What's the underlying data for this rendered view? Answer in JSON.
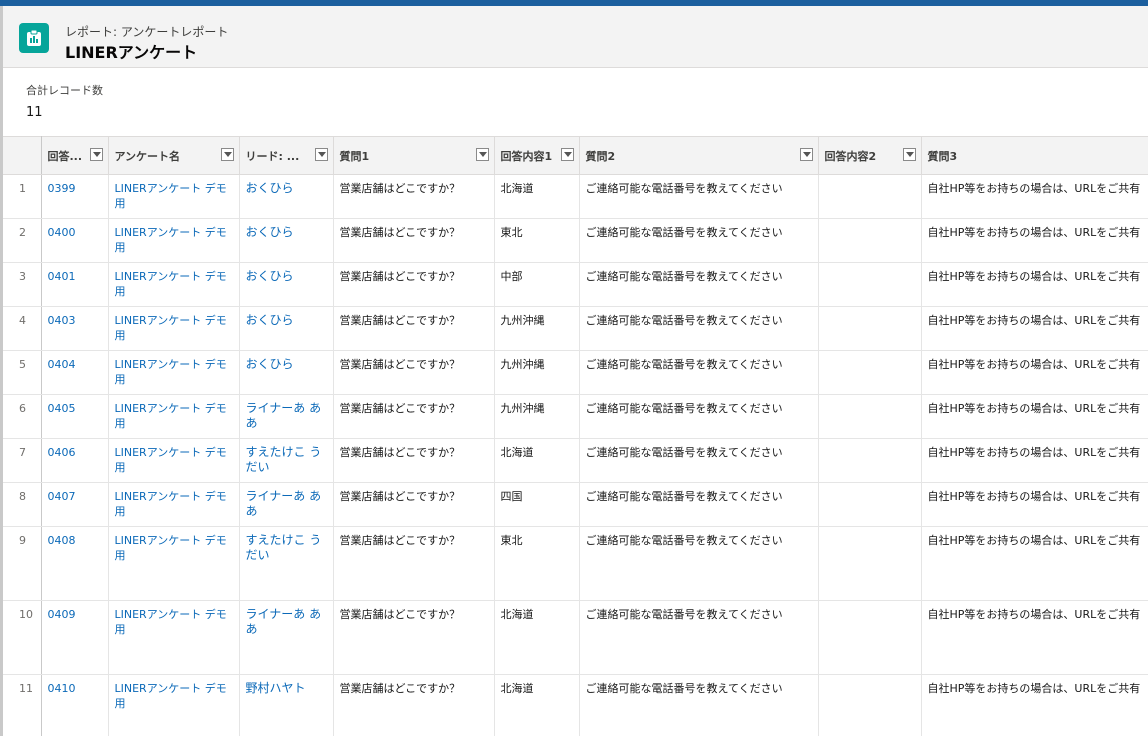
{
  "header": {
    "subtitle": "レポート: アンケートレポート",
    "title": "LINERアンケート"
  },
  "summary": {
    "label": "合計レコード数",
    "value": "11"
  },
  "table": {
    "columns": [
      "回答...",
      "アンケート名",
      "リード: ...",
      "質問1",
      "回答内容1",
      "質問2",
      "回答内容2",
      "質問3"
    ],
    "rows": [
      [
        "1",
        "0399",
        "LINERアンケート デモ用",
        "おくひら",
        "営業店舗はどこですか？",
        "北海道",
        "ご連絡可能な電話番号を教えてください",
        "",
        "自社HP等をお持ちの場合は、URLをご共有"
      ],
      [
        "2",
        "0400",
        "LINERアンケート デモ用",
        "おくひら",
        "営業店舗はどこですか？",
        "東北",
        "ご連絡可能な電話番号を教えてください",
        "",
        "自社HP等をお持ちの場合は、URLをご共有"
      ],
      [
        "3",
        "0401",
        "LINERアンケート デモ用",
        "おくひら",
        "営業店舗はどこですか？",
        "中部",
        "ご連絡可能な電話番号を教えてください",
        "",
        "自社HP等をお持ちの場合は、URLをご共有"
      ],
      [
        "4",
        "0403",
        "LINERアンケート デモ用",
        "おくひら",
        "営業店舗はどこですか？",
        "九州沖縄",
        "ご連絡可能な電話番号を教えてください",
        "",
        "自社HP等をお持ちの場合は、URLをご共有"
      ],
      [
        "5",
        "0404",
        "LINERアンケート デモ用",
        "おくひら",
        "営業店舗はどこですか？",
        "九州沖縄",
        "ご連絡可能な電話番号を教えてください",
        "",
        "自社HP等をお持ちの場合は、URLをご共有"
      ],
      [
        "6",
        "0405",
        "LINERアンケート デモ用",
        "ライナーあ ああ",
        "営業店舗はどこですか？",
        "九州沖縄",
        "ご連絡可能な電話番号を教えてください",
        "",
        "自社HP等をお持ちの場合は、URLをご共有"
      ],
      [
        "7",
        "0406",
        "LINERアンケート デモ用",
        "すえたけこ うだい",
        "営業店舗はどこですか？",
        "北海道",
        "ご連絡可能な電話番号を教えてください",
        "",
        "自社HP等をお持ちの場合は、URLをご共有"
      ],
      [
        "8",
        "0407",
        "LINERアンケート デモ用",
        "ライナーあ ああ",
        "営業店舗はどこですか？",
        "四国",
        "ご連絡可能な電話番号を教えてください",
        "",
        "自社HP等をお持ちの場合は、URLをご共有"
      ],
      [
        "9",
        "0408",
        "LINERアンケート デモ用",
        "すえたけこ うだい",
        "営業店舗はどこですか？",
        "東北",
        "ご連絡可能な電話番号を教えてください",
        "",
        "自社HP等をお持ちの場合は、URLをご共有"
      ],
      [
        "10",
        "0409",
        "LINERアンケート デモ用",
        "ライナーあ ああ",
        "営業店舗はどこですか？",
        "北海道",
        "ご連絡可能な電話番号を教えてください",
        "",
        "自社HP等をお持ちの場合は、URLをご共有"
      ],
      [
        "11",
        "0410",
        "LINERアンケート デモ用",
        "野村ハヤト",
        "営業店舗はどこですか？",
        "北海道",
        "ご連絡可能な電話番号を教えてください",
        "",
        "自社HP等をお持ちの場合は、URLをご共有"
      ]
    ]
  },
  "icons": {
    "header": "report-icon",
    "column_menu": "chevron-down-icon"
  },
  "colors": {
    "accent": "#06a59a",
    "link": "#0b69b8",
    "top_strip": "#1b5f9e"
  }
}
